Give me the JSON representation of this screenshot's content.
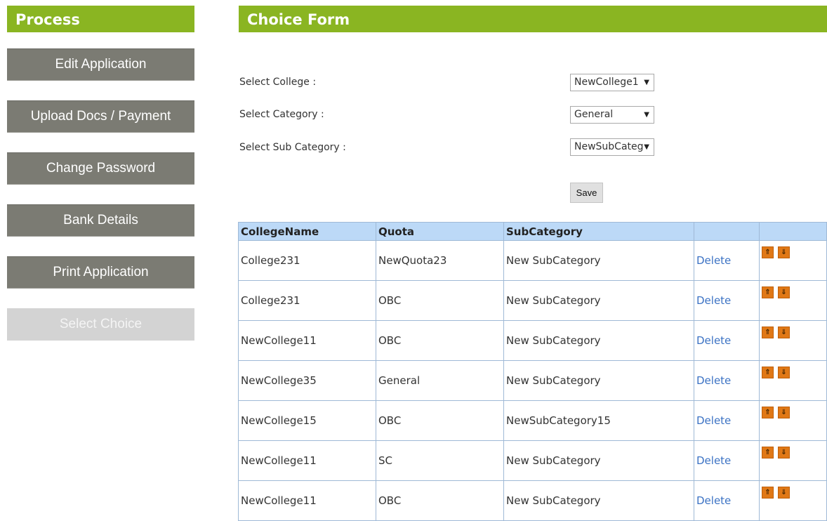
{
  "sidebar": {
    "header": "Process",
    "items": [
      {
        "label": "Edit Application"
      },
      {
        "label": "Upload Docs / Payment"
      },
      {
        "label": "Change Password"
      },
      {
        "label": "Bank Details"
      },
      {
        "label": "Print Application"
      },
      {
        "label": "Select Choice",
        "disabled": true
      }
    ]
  },
  "form": {
    "header": "Choice Form",
    "college_label": "Select College :",
    "college_value": "NewCollege1",
    "category_label": "Select Category :",
    "category_value": "General",
    "subcategory_label": "Select Sub Category :",
    "subcategory_value": "NewSubCategory",
    "save_label": "Save"
  },
  "table": {
    "columns": [
      "CollegeName",
      "Quota",
      "SubCategory",
      "",
      ""
    ],
    "rows": [
      {
        "college": "College231",
        "quota": "NewQuota23",
        "subcategory": "New SubCategory",
        "action": "Delete"
      },
      {
        "college": "College231",
        "quota": "OBC",
        "subcategory": "New SubCategory",
        "action": "Delete"
      },
      {
        "college": "NewCollege11",
        "quota": "OBC",
        "subcategory": "New SubCategory",
        "action": "Delete"
      },
      {
        "college": "NewCollege35",
        "quota": "General",
        "subcategory": "New SubCategory",
        "action": "Delete"
      },
      {
        "college": "NewCollege15",
        "quota": "OBC",
        "subcategory": "NewSubCategory15",
        "action": "Delete"
      },
      {
        "college": "NewCollege11",
        "quota": "SC",
        "subcategory": "New SubCategory",
        "action": "Delete"
      },
      {
        "college": "NewCollege11",
        "quota": "OBC",
        "subcategory": "New SubCategory",
        "action": "Delete"
      }
    ]
  },
  "icons": {
    "move_up": "⇑",
    "move_down": "⇓",
    "dropdown": "▼"
  },
  "colors": {
    "header_green": "#8ab522",
    "button_gray": "#7b7b73",
    "disabled_gray": "#d3d3d3",
    "table_header_blue": "#bcd9f7",
    "link_blue": "#3b72c4",
    "arrow_orange": "#e07816"
  }
}
